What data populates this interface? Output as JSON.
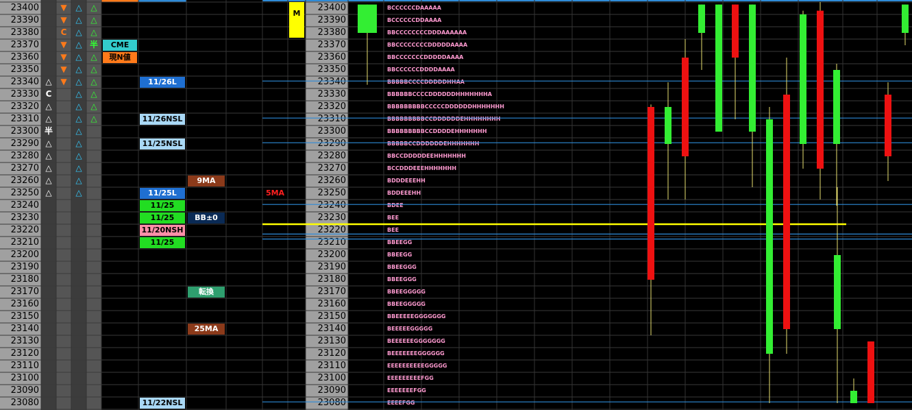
{
  "price_levels": [
    23400,
    23390,
    23380,
    23370,
    23360,
    23350,
    23340,
    23330,
    23320,
    23310,
    23300,
    23290,
    23280,
    23270,
    23260,
    23250,
    23240,
    23230,
    23220,
    23210,
    23200,
    23190,
    23180,
    23170,
    23160,
    23150,
    23140,
    23130,
    23120,
    23110,
    23100,
    23090,
    23080
  ],
  "symbols": [
    {
      "level": 23400,
      "col": 1,
      "text": "▼",
      "color": "#ff7a1a"
    },
    {
      "level": 23400,
      "col": 2,
      "text": "△",
      "color": "#33ccff"
    },
    {
      "level": 23400,
      "col": 3,
      "text": "△",
      "color": "#33ff33"
    },
    {
      "level": 23390,
      "col": 1,
      "text": "▼",
      "color": "#ff7a1a"
    },
    {
      "level": 23390,
      "col": 2,
      "text": "△",
      "color": "#33ccff"
    },
    {
      "level": 23390,
      "col": 3,
      "text": "△",
      "color": "#33ff33"
    },
    {
      "level": 23380,
      "col": 1,
      "text": "C",
      "color": "#ff7a1a"
    },
    {
      "level": 23380,
      "col": 2,
      "text": "△",
      "color": "#33ccff"
    },
    {
      "level": 23380,
      "col": 3,
      "text": "△",
      "color": "#33ff33"
    },
    {
      "level": 23370,
      "col": 1,
      "text": "▼",
      "color": "#ff7a1a"
    },
    {
      "level": 23370,
      "col": 2,
      "text": "△",
      "color": "#33ccff"
    },
    {
      "level": 23370,
      "col": 3,
      "text": "半",
      "color": "#33ff33"
    },
    {
      "level": 23360,
      "col": 1,
      "text": "▼",
      "color": "#ff7a1a"
    },
    {
      "level": 23360,
      "col": 2,
      "text": "△",
      "color": "#33ccff"
    },
    {
      "level": 23360,
      "col": 3,
      "text": "△",
      "color": "#33ff33"
    },
    {
      "level": 23350,
      "col": 1,
      "text": "▼",
      "color": "#ff7a1a"
    },
    {
      "level": 23350,
      "col": 2,
      "text": "△",
      "color": "#33ccff"
    },
    {
      "level": 23350,
      "col": 3,
      "text": "△",
      "color": "#33ff33"
    },
    {
      "level": 23340,
      "col": 0,
      "text": "△",
      "color": "#ffffff"
    },
    {
      "level": 23340,
      "col": 1,
      "text": "▼",
      "color": "#ff7a1a"
    },
    {
      "level": 23340,
      "col": 2,
      "text": "△",
      "color": "#33ccff"
    },
    {
      "level": 23340,
      "col": 3,
      "text": "△",
      "color": "#33ff33"
    },
    {
      "level": 23330,
      "col": 0,
      "text": "C",
      "color": "#ffffff"
    },
    {
      "level": 23330,
      "col": 2,
      "text": "△",
      "color": "#33ccff"
    },
    {
      "level": 23330,
      "col": 3,
      "text": "△",
      "color": "#33ff33"
    },
    {
      "level": 23320,
      "col": 0,
      "text": "△",
      "color": "#ffffff"
    },
    {
      "level": 23320,
      "col": 2,
      "text": "△",
      "color": "#33ccff"
    },
    {
      "level": 23320,
      "col": 3,
      "text": "△",
      "color": "#33ff33"
    },
    {
      "level": 23310,
      "col": 0,
      "text": "△",
      "color": "#ffffff"
    },
    {
      "level": 23310,
      "col": 2,
      "text": "△",
      "color": "#33ccff"
    },
    {
      "level": 23310,
      "col": 3,
      "text": "△",
      "color": "#33ff33"
    },
    {
      "level": 23300,
      "col": 0,
      "text": "半",
      "color": "#ffffff"
    },
    {
      "level": 23300,
      "col": 2,
      "text": "△",
      "color": "#33ccff"
    },
    {
      "level": 23290,
      "col": 0,
      "text": "△",
      "color": "#ffffff"
    },
    {
      "level": 23290,
      "col": 2,
      "text": "△",
      "color": "#33ccff"
    },
    {
      "level": 23280,
      "col": 0,
      "text": "△",
      "color": "#ffffff"
    },
    {
      "level": 23280,
      "col": 2,
      "text": "△",
      "color": "#33ccff"
    },
    {
      "level": 23270,
      "col": 0,
      "text": "△",
      "color": "#ffffff"
    },
    {
      "level": 23270,
      "col": 2,
      "text": "△",
      "color": "#33ccff"
    },
    {
      "level": 23260,
      "col": 0,
      "text": "△",
      "color": "#ffffff"
    },
    {
      "level": 23260,
      "col": 2,
      "text": "△",
      "color": "#33ccff"
    },
    {
      "level": 23250,
      "col": 0,
      "text": "△",
      "color": "#ffffff"
    },
    {
      "level": 23250,
      "col": 2,
      "text": "△",
      "color": "#33ccff"
    }
  ],
  "labels": [
    {
      "level": 23370,
      "col": "a",
      "text": "CME",
      "bg": "#33cccc",
      "fg": "#000000"
    },
    {
      "level": 23360,
      "col": "a",
      "text": "現N値",
      "bg": "#ff7a1a",
      "fg": "#000000"
    },
    {
      "level": 23340,
      "col": "b",
      "text": "11/26L",
      "bg": "#1f6fd1",
      "fg": "#ffffff"
    },
    {
      "level": 23310,
      "col": "b",
      "text": "11/26NSL",
      "bg": "#a9d8f5",
      "fg": "#000000"
    },
    {
      "level": 23290,
      "col": "b",
      "text": "11/25NSL",
      "bg": "#a9d8f5",
      "fg": "#000000"
    },
    {
      "level": 23260,
      "col": "c",
      "text": "9MA",
      "bg": "#8b3a1a",
      "fg": "#ffffff"
    },
    {
      "level": 23250,
      "col": "b",
      "text": "11/25L",
      "bg": "#1f6fd1",
      "fg": "#ffffff"
    },
    {
      "level": 23250,
      "col": "d",
      "text": "5MA",
      "bg": "#000000",
      "fg": "#ff2020"
    },
    {
      "level": 23240,
      "col": "b",
      "text": "11/25",
      "bg": "#22dd22",
      "fg": "#000000"
    },
    {
      "level": 23230,
      "col": "b",
      "text": "11/25",
      "bg": "#22dd22",
      "fg": "#000000"
    },
    {
      "level": 23230,
      "col": "c",
      "text": "BB±0",
      "bg": "#0a2a55",
      "fg": "#ffffff"
    },
    {
      "level": 23220,
      "col": "b",
      "text": "11/20NSH",
      "bg": "#ff8fa8",
      "fg": "#000000"
    },
    {
      "level": 23210,
      "col": "b",
      "text": "11/25",
      "bg": "#22dd22",
      "fg": "#000000"
    },
    {
      "level": 23170,
      "col": "c",
      "text": "転換",
      "bg": "#2e9e6e",
      "fg": "#ffffff"
    },
    {
      "level": 23140,
      "col": "c",
      "text": "25MA",
      "bg": "#8b3a1a",
      "fg": "#ffffff"
    },
    {
      "level": 23080,
      "col": "b",
      "text": "11/22NSL",
      "bg": "#a9d8f5",
      "fg": "#000000"
    },
    {
      "level": 23390,
      "col": "m",
      "text": "M",
      "bg": "#ffff00",
      "fg": "#000000"
    }
  ],
  "tpo_profile": [
    {
      "level": 23400,
      "text": "BCCCCCCDAAAAA"
    },
    {
      "level": 23390,
      "text": "BCCCCCCDDAAAA"
    },
    {
      "level": 23380,
      "text": "BBCCCCCCCCDDDAAAAAA"
    },
    {
      "level": 23370,
      "text": "BBCCCCCCCCDDDDDAAAA"
    },
    {
      "level": 23360,
      "text": "BBCCCCCCCDDDDDAAAA"
    },
    {
      "level": 23350,
      "text": "BBCCCCCCDDDDAAAA"
    },
    {
      "level": 23340,
      "text": "BBBBBCCCCDDDDDHHAA"
    },
    {
      "level": 23330,
      "text": "BBBBBBCCCCDDDDDDHHHHHHHA"
    },
    {
      "level": 23320,
      "text": "BBBBBBBBBCCCCCDDDDDDHHHHHHH"
    },
    {
      "level": 23310,
      "text": "BBBBBBBBBCCDDDDDDEHHHHHHHH"
    },
    {
      "level": 23300,
      "text": "BBBBBBBBBCCDDDDEHHHHHHH"
    },
    {
      "level": 23290,
      "text": "BBBBBCCDDDDDDEHHHHHHH"
    },
    {
      "level": 23280,
      "text": "BBCCDDDDDEEHHHHHHH"
    },
    {
      "level": 23270,
      "text": "BCCDDDEEEHHHHHHH"
    },
    {
      "level": 23260,
      "text": "BDDDEEEHH"
    },
    {
      "level": 23250,
      "text": "BDDEEEHH"
    },
    {
      "level": 23240,
      "text": "BDEE"
    },
    {
      "level": 23230,
      "text": "BEE"
    },
    {
      "level": 23220,
      "text": "BEE"
    },
    {
      "level": 23210,
      "text": "BBEEGG"
    },
    {
      "level": 23200,
      "text": "BBEEGG"
    },
    {
      "level": 23190,
      "text": "BBEEGGG"
    },
    {
      "level": 23180,
      "text": "BBEEGGG"
    },
    {
      "level": 23170,
      "text": "BBEEGGGGG"
    },
    {
      "level": 23160,
      "text": "BBEEGGGGG"
    },
    {
      "level": 23150,
      "text": "BBEEEEEGGGGGGG"
    },
    {
      "level": 23140,
      "text": "BEEEEEGGGGG"
    },
    {
      "level": 23130,
      "text": "BEEEEEEGGGGGGG"
    },
    {
      "level": 23120,
      "text": "BEEEEEEEGGGGGG"
    },
    {
      "level": 23110,
      "text": "EEEEEEEEEEGGGGG"
    },
    {
      "level": 23100,
      "text": "EEEEEEEEEFGG"
    },
    {
      "level": 23090,
      "text": "EEEEEEEFGG"
    },
    {
      "level": 23080,
      "text": "EEEEFGG"
    }
  ],
  "horizontal_lines": [
    {
      "price": 23341,
      "color": "#2e8bd8"
    },
    {
      "price": 23311,
      "color": "#2e8bd8"
    },
    {
      "price": 23291,
      "color": "#2e8bd8"
    },
    {
      "price": 23241,
      "color": "#2e8bd8"
    },
    {
      "price": 23225,
      "color": "#ffff00"
    },
    {
      "price": 23217,
      "color": "#2e8bd8"
    },
    {
      "price": 23213,
      "color": "#2e8bd8"
    },
    {
      "price": 23081,
      "color": "#2e8bd8"
    }
  ],
  "chart_data": {
    "type": "candlestick",
    "y_axis_levels": [
      23400,
      23080
    ],
    "step": 10,
    "grid": true,
    "candles": [
      {
        "open": 23380,
        "close": 23403,
        "high": 23403,
        "low": 23338,
        "color": "green"
      },
      {
        "open": 23180,
        "close": 23320,
        "high": 23322,
        "low": 23135,
        "color": "red"
      },
      {
        "open": 23290,
        "close": 23320,
        "high": 23340,
        "low": 23245,
        "color": "green"
      },
      {
        "open": 23300,
        "close": 23360,
        "high": 23372,
        "low": 23255,
        "color": "green"
      },
      {
        "open": 23360,
        "close": 23280,
        "high": 23375,
        "low": 23245,
        "color": "red"
      },
      {
        "open": 23380,
        "close": 23403,
        "high": 23403,
        "low": 23350,
        "color": "green"
      },
      {
        "open": 23300,
        "close": 23403,
        "high": 23403,
        "low": 23300,
        "color": "green"
      },
      {
        "open": 23403,
        "close": 23360,
        "high": 23403,
        "low": 23310,
        "color": "red"
      },
      {
        "open": 23300,
        "close": 23403,
        "high": 23403,
        "low": 23255,
        "color": "green"
      },
      {
        "open": 23120,
        "close": 23310,
        "high": 23320,
        "low": 23080,
        "color": "green"
      },
      {
        "open": 23330,
        "close": 23140,
        "high": 23360,
        "low": 23120,
        "color": "red"
      },
      {
        "open": 23290,
        "close": 23395,
        "high": 23398,
        "low": 23270,
        "color": "green"
      },
      {
        "open": 23398,
        "close": 23270,
        "high": 23405,
        "low": 23245,
        "color": "red"
      },
      {
        "open": 23290,
        "close": 23350,
        "high": 23355,
        "low": 23240,
        "color": "green"
      },
      {
        "open": 23140,
        "close": 23200,
        "high": 23255,
        "low": 23080,
        "color": "green"
      },
      {
        "open": 23080,
        "close": 23090,
        "high": 23100,
        "low": 23080,
        "color": "green"
      },
      {
        "open": 23130,
        "close": 23080,
        "high": 23130,
        "low": 23080,
        "color": "red"
      },
      {
        "open": 23330,
        "close": 23280,
        "high": 23340,
        "low": 23260,
        "color": "red"
      },
      {
        "open": 23380,
        "close": 23403,
        "high": 23403,
        "low": 23370,
        "color": "green"
      }
    ]
  }
}
